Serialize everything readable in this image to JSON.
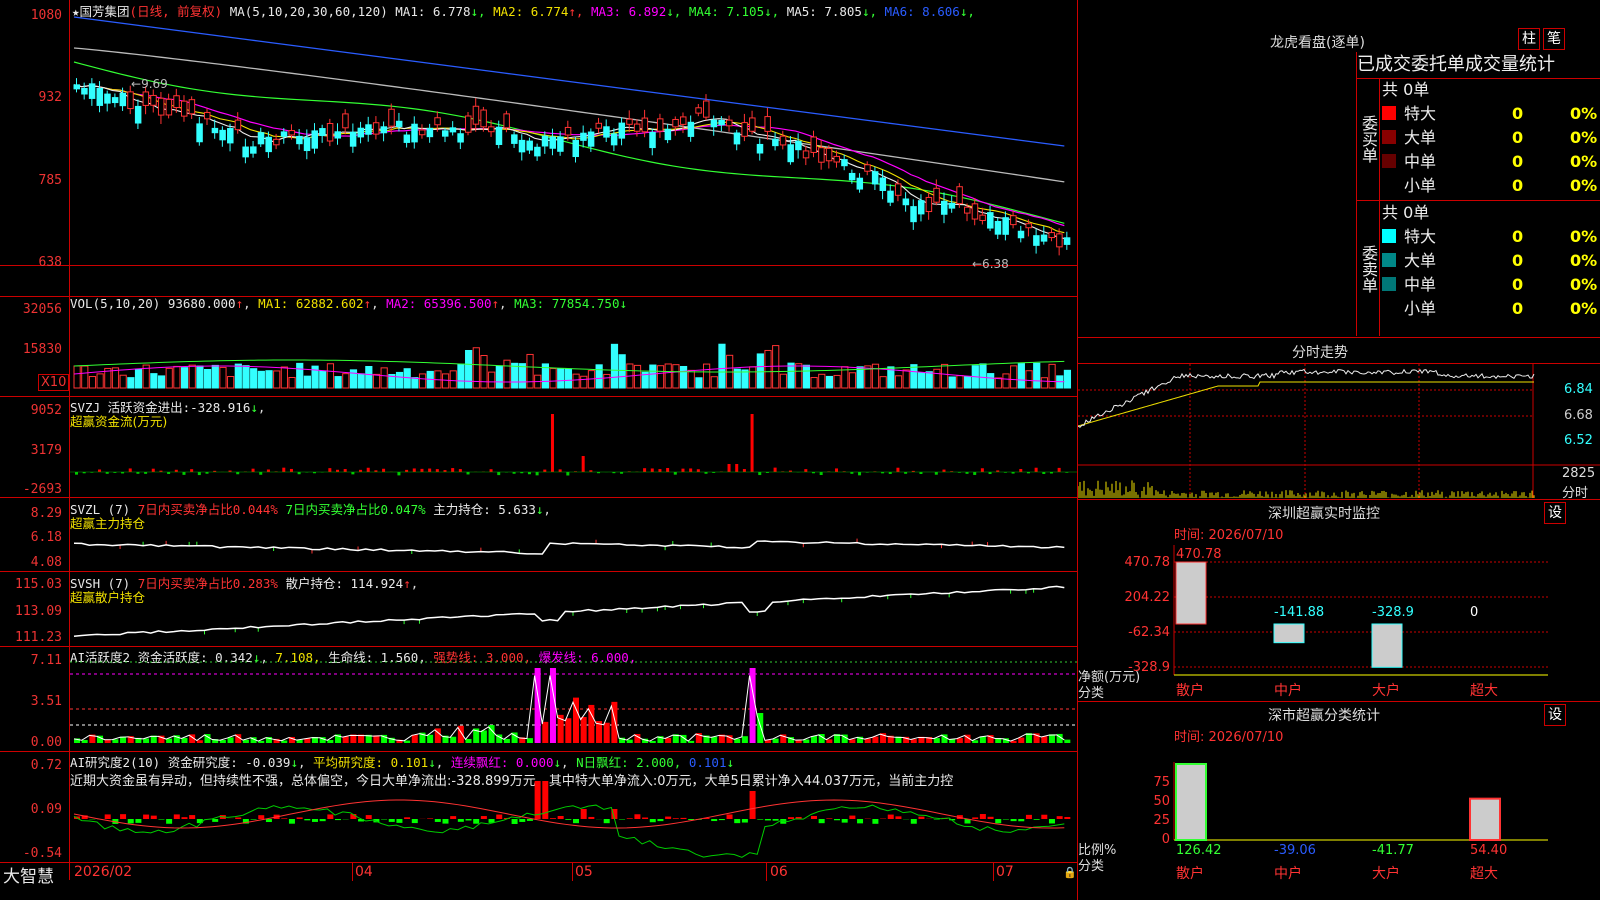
{
  "main_chart": {
    "stock_name": "国芳集团",
    "period": "(日线, 前复权)",
    "ma_label": "MA(5,10,20,30,60,120)",
    "ma_values": [
      {
        "label": "MA1:",
        "value": "6.778",
        "arrow": "↓",
        "color": "#e8e8e8"
      },
      {
        "label": "MA2:",
        "value": "6.774",
        "arrow": "↑",
        "color": "#f0e000"
      },
      {
        "label": "MA3:",
        "value": "6.892",
        "arrow": "↓",
        "color": "#ff00ff"
      },
      {
        "label": "MA4:",
        "value": "7.105",
        "arrow": "↓",
        "color": "#33ff33"
      },
      {
        "label": "MA5:",
        "value": "7.805",
        "arrow": "↓",
        "color": "#e8e8e8"
      },
      {
        "label": "MA6:",
        "value": "8.606",
        "arrow": "↓",
        "color": "#2a5cff"
      }
    ],
    "y_ticks": [
      "1080",
      "932",
      "785",
      "638"
    ],
    "high_label": "9.69",
    "low_label": "←6.38"
  },
  "vol_panel": {
    "title": "VOL(5,10,20)",
    "vol": "93680.000",
    "ma1": "62882.602",
    "ma2": "65396.500",
    "ma3": "77854.750",
    "y_ticks": [
      "32056",
      "15830"
    ],
    "unit": "X10"
  },
  "svzj_panel": {
    "title": "SVZJ  活跃资金进出:",
    "value": "-328.916",
    "subtitle": "超赢资金流(万元)",
    "y_ticks": [
      "9052",
      "3179",
      "-2693"
    ]
  },
  "svzl_panel": {
    "title": "SVZL (7)",
    "net1": "7日内买卖净占比0.044%",
    "net2": "7日内买卖净占比0.047%",
    "hold": "主力持仓: 5.633",
    "subtitle": "超赢主力持仓",
    "y_ticks": [
      "8.29",
      "6.18",
      "4.08"
    ]
  },
  "svsh_panel": {
    "title": "SVSH (7)",
    "net": "7日内买卖净占比0.283%",
    "hold": "散户持仓: 114.924",
    "subtitle": "超赢散户持仓",
    "y_ticks": [
      "115.03",
      "113.09",
      "111.23"
    ]
  },
  "ai_active_panel": {
    "title": "AI活跃度2",
    "active": "资金活跃度: 0.342",
    "v2": "7.108,",
    "life": "生命线: 1.560,",
    "strong": "强势线: 3.000,",
    "burst": "爆发线: 6.000,",
    "y_ticks": [
      "7.11",
      "3.51",
      "0.00"
    ]
  },
  "ai_research_panel": {
    "title": "AI研究度2(10)",
    "research": "资金研究度: -0.039",
    "avg": "平均研究度: 0.101",
    "streak": "连续飘红: 0.000",
    "nday": "N日飘红: 2.000,",
    "nday_v": "0.101",
    "comment": "近期大资金虽有异动，但持续性不强，总体偏空，今日大单净流出:-328.899万元，其中特大单净流入:0万元，大单5日累计净入44.037万元，当前主力控",
    "y_ticks": [
      "0.72",
      "0.09",
      "-0.54"
    ]
  },
  "x_axis": {
    "brand": "大智慧",
    "labels": [
      "2026/02",
      "04",
      "05",
      "06",
      "07"
    ]
  },
  "right_panel": {
    "title": "龙虎看盘(逐单)",
    "btn_bar": "柱",
    "btn_pen": "笔",
    "stats_title": "已成交委托单成交量统计",
    "buy_side": "委买单",
    "sell_side": "委卖单",
    "buy_total": "共 0单",
    "sell_total": "共 0单",
    "buy_rows": [
      {
        "label": "特大",
        "count": "0",
        "pct": "0%",
        "color": "#ff0000"
      },
      {
        "label": "大单",
        "count": "0",
        "pct": "0%",
        "color": "#880000"
      },
      {
        "label": "中单",
        "count": "0",
        "pct": "0%",
        "color": "#660000"
      },
      {
        "label": "小单",
        "count": "0",
        "pct": "0%",
        "color": "#000000"
      }
    ],
    "sell_rows": [
      {
        "label": "特大",
        "count": "0",
        "pct": "0%",
        "color": "#00ffff"
      },
      {
        "label": "大单",
        "count": "0",
        "pct": "0%",
        "color": "#008888"
      },
      {
        "label": "中单",
        "count": "0",
        "pct": "0%",
        "color": "#007777"
      },
      {
        "label": "小单",
        "count": "0",
        "pct": "0%",
        "color": "#000000"
      }
    ],
    "intraday_title": "分时走势",
    "intraday_y": [
      "6.84",
      "6.68",
      "6.52"
    ],
    "intraday_vol": "2825",
    "intraday_vol_lbl": "分时",
    "sz_monitor": {
      "title": "深圳超赢实时监控",
      "btn": "设",
      "time": "时间: 2026/07/10",
      "y_ticks": [
        "470.78",
        "204.22",
        "-62.34",
        "-328.9"
      ],
      "unit_lbl": "净额(万元)",
      "cat_lbl": "分类",
      "bars": [
        {
          "cat": "散户",
          "value": "470.78"
        },
        {
          "cat": "中户",
          "value": "-141.88"
        },
        {
          "cat": "大户",
          "value": "-328.9"
        },
        {
          "cat": "超大",
          "value": "0"
        }
      ]
    },
    "sz_class": {
      "title": "深市超赢分类统计",
      "btn": "设",
      "time": "时间: 2026/07/10",
      "y_ticks": [
        "75",
        "50",
        "25",
        "0"
      ],
      "unit_lbl": "比例%",
      "cat_lbl": "分类",
      "bars": [
        {
          "cat": "散户",
          "value": "126.42",
          "color": "#33ff33"
        },
        {
          "cat": "中户",
          "value": "-39.06",
          "color": "#2a5cff"
        },
        {
          "cat": "大户",
          "value": "-41.77",
          "color": "#33ff33"
        },
        {
          "cat": "超大",
          "value": "54.40",
          "color": "#ff3333"
        }
      ]
    }
  }
}
